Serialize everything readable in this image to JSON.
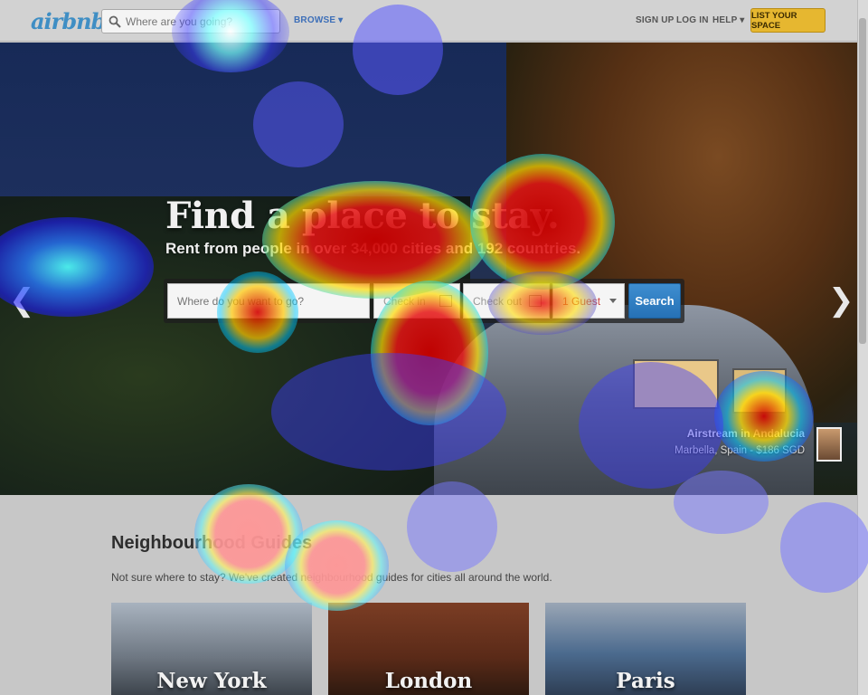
{
  "nav": {
    "logo": "airbnb",
    "search_placeholder": "Where are you going?",
    "browse": "BROWSE ▾",
    "signup": "SIGN UP",
    "login": "LOG IN",
    "help": "HELP ▾",
    "list_space": "LIST YOUR SPACE"
  },
  "hero": {
    "title": "Find a place to stay.",
    "subtitle": "Rent from people in over 34,000 cities and 192 countries.",
    "search": {
      "where_placeholder": "Where do you want to go?",
      "checkin": "Check in",
      "checkout": "Check out",
      "guests": "1 Guest",
      "button": "Search"
    },
    "caption_title": "Airstream in Andalucia",
    "caption_sub": "Marbella, Spain - $186 SGD"
  },
  "guides": {
    "title": "Neighbourhood Guides",
    "description": "Not sure where to stay? We've created neighbourhood guides for cities all around the world.",
    "cities": [
      "New York",
      "London",
      "Paris"
    ]
  },
  "icons": {
    "search": "search-icon",
    "calendar": "calendar-icon",
    "prev": "chevron-left-icon",
    "next": "chevron-right-icon"
  }
}
